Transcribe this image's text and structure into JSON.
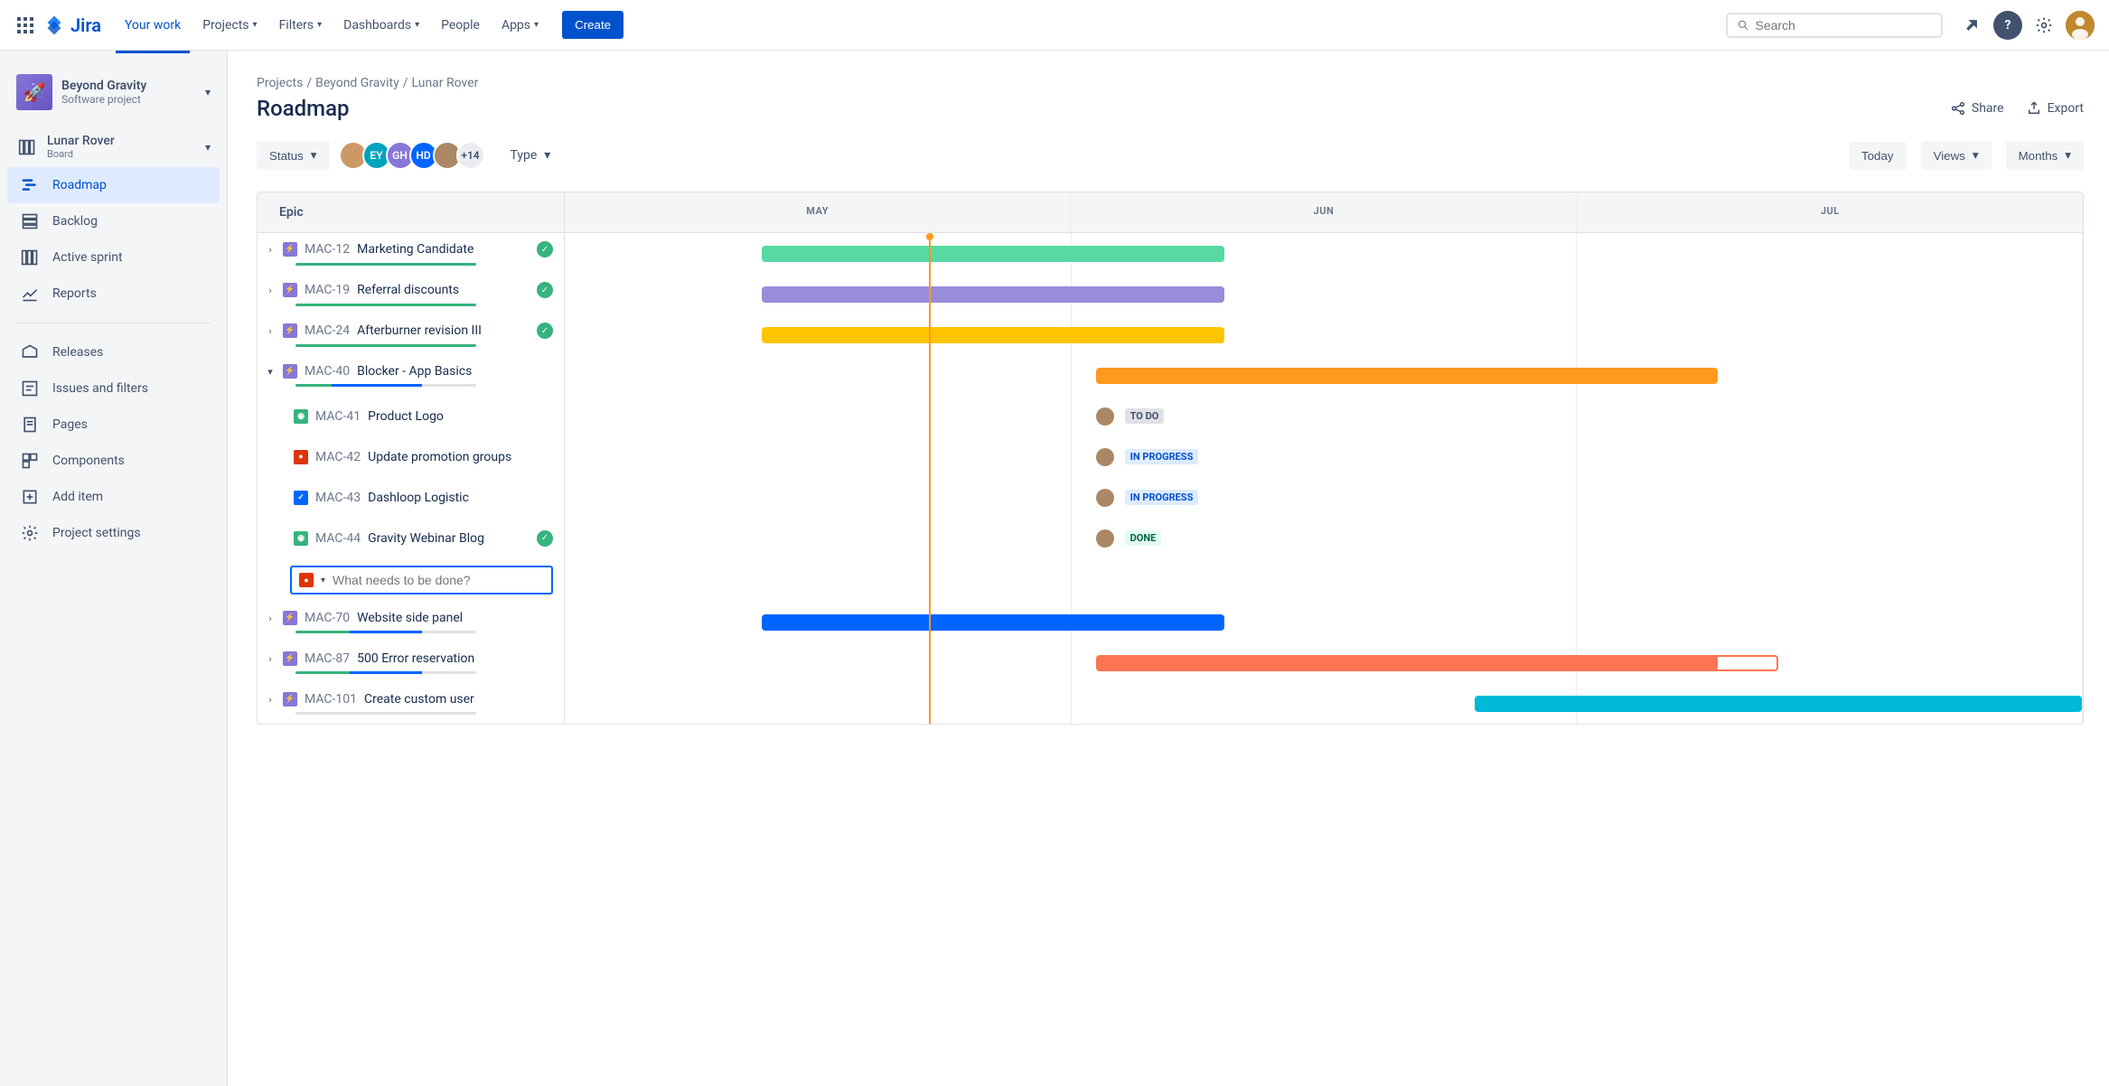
{
  "app": {
    "name": "Jira"
  },
  "topnav": {
    "items": [
      {
        "label": "Your work",
        "active": true
      },
      {
        "label": "Projects",
        "chev": true
      },
      {
        "label": "Filters",
        "chev": true
      },
      {
        "label": "Dashboards",
        "chev": true
      },
      {
        "label": "People"
      },
      {
        "label": "Apps",
        "chev": true
      }
    ],
    "create": "Create",
    "search_placeholder": "Search",
    "more_avatars": "+14"
  },
  "project": {
    "name": "Beyond Gravity",
    "type": "Software project",
    "board": {
      "name": "Lunar Rover",
      "sub": "Board"
    }
  },
  "sidenav": {
    "top": [
      {
        "label": "Roadmap",
        "icon": "roadmap",
        "active": true
      },
      {
        "label": "Backlog",
        "icon": "backlog"
      },
      {
        "label": "Active sprint",
        "icon": "sprint"
      },
      {
        "label": "Reports",
        "icon": "reports"
      }
    ],
    "bottom": [
      {
        "label": "Releases",
        "icon": "releases"
      },
      {
        "label": "Issues and filters",
        "icon": "issues"
      },
      {
        "label": "Pages",
        "icon": "pages"
      },
      {
        "label": "Components",
        "icon": "components"
      },
      {
        "label": "Add item",
        "icon": "add"
      },
      {
        "label": "Project settings",
        "icon": "settings"
      }
    ]
  },
  "breadcrumb": [
    "Projects",
    "Beyond Gravity",
    "Lunar Rover"
  ],
  "page": {
    "title": "Roadmap",
    "share": "Share",
    "export": "Export"
  },
  "filters": {
    "status": "Status",
    "type": "Type",
    "today": "Today",
    "views": "Views",
    "months": "Months",
    "avatars": [
      "",
      "EY",
      "GH",
      "HD",
      ""
    ]
  },
  "roadmap": {
    "epicColLabel": "Epic",
    "months": [
      "MAY",
      "JUN",
      "JUL"
    ],
    "new_item_placeholder": "What needs to be done?",
    "today_pct": 24,
    "epics": [
      {
        "key": "MAC-12",
        "summary": "Marketing Candidate",
        "color": "green",
        "start": 13,
        "end": 43.5,
        "done": 100,
        "check": true
      },
      {
        "key": "MAC-19",
        "summary": "Referral discounts",
        "color": "purple",
        "start": 13,
        "end": 43.5,
        "done": 100,
        "check": true
      },
      {
        "key": "MAC-24",
        "summary": "Afterburner revision III",
        "color": "yellow",
        "start": 13,
        "end": 43.5,
        "done": 100,
        "check": true
      },
      {
        "key": "MAC-40",
        "summary": "Blocker - App Basics",
        "color": "orange",
        "start": 35,
        "end": 76,
        "done": 20,
        "prog": 50,
        "expanded": true,
        "children": [
          {
            "type": "story",
            "key": "MAC-41",
            "summary": "Product Logo",
            "status": "TO DO",
            "status_class": "todo"
          },
          {
            "type": "bug",
            "key": "MAC-42",
            "summary": "Update promotion groups",
            "status": "IN PROGRESS",
            "status_class": "prog"
          },
          {
            "type": "task",
            "key": "MAC-43",
            "summary": "Dashloop Logistic",
            "status": "IN PROGRESS",
            "status_class": "prog"
          },
          {
            "type": "story",
            "key": "MAC-44",
            "summary": "Gravity Webinar Blog",
            "status": "DONE",
            "status_class": "done",
            "check": true
          }
        ]
      },
      {
        "key": "MAC-70",
        "summary": "Website side panel",
        "color": "blue",
        "start": 13,
        "end": 43.5,
        "done": 30,
        "prog": 40
      },
      {
        "key": "MAC-87",
        "summary": "500 Error reservation",
        "color": "red",
        "start": 35,
        "end": 76,
        "done": 30,
        "prog": 40
      },
      {
        "key": "MAC-101",
        "summary": "Create custom user",
        "color": "cyan",
        "start": 60,
        "end": 100,
        "partial": true
      }
    ]
  }
}
